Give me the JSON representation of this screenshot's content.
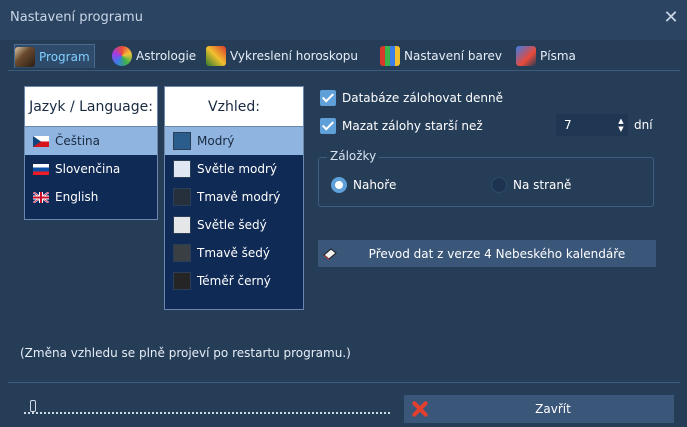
{
  "window": {
    "title": "Nastavení programu",
    "close_glyph": "✕"
  },
  "tabs": [
    {
      "label": "Program",
      "icon": "wizard-icon",
      "active": true
    },
    {
      "label": "Astrologie",
      "icon": "zodiac-wheel-icon",
      "active": false
    },
    {
      "label": "Vykreslení horoskopu",
      "icon": "paint-brush-icon",
      "active": false
    },
    {
      "label": "Nastavení barev",
      "icon": "color-bars-icon",
      "active": false
    },
    {
      "label": "Písma",
      "icon": "fonts-icon",
      "active": false
    }
  ],
  "language": {
    "header": "Jazyk / Language:",
    "items": [
      {
        "label": "Čeština",
        "flag": "czech-flag-icon",
        "selected": true
      },
      {
        "label": "Slovenčina",
        "flag": "slovak-flag-icon",
        "selected": false
      },
      {
        "label": "English",
        "flag": "uk-flag-icon",
        "selected": false
      }
    ]
  },
  "appearance": {
    "header": "Vzhled:",
    "items": [
      {
        "label": "Modrý",
        "color": "#2a5c8c",
        "selected": true
      },
      {
        "label": "Světle modrý",
        "color": "#dfe8f2",
        "selected": false
      },
      {
        "label": "Tmavě modrý",
        "color": "#26303c",
        "selected": false
      },
      {
        "label": "Světle šedý",
        "color": "#e4e6e8",
        "selected": false
      },
      {
        "label": "Tmavě šedý",
        "color": "#3a3f44",
        "selected": false
      },
      {
        "label": "Téměř černý",
        "color": "#252525",
        "selected": false
      }
    ]
  },
  "options": {
    "backup_daily": {
      "label": "Databáze zálohovat denně",
      "checked": true
    },
    "delete_older": {
      "label": "Mazat zálohy starší než",
      "checked": true
    },
    "days_value": "7",
    "days_unit": "dní"
  },
  "tabs_position": {
    "legend": "Záložky",
    "top": {
      "label": "Nahoře",
      "selected": true
    },
    "side": {
      "label": "Na straně",
      "selected": false
    }
  },
  "convert_button": {
    "label": "Převod dat z verze 4 Nebeského kalendáře"
  },
  "note": "(Změna vzhledu se plně projeví po restartu programu.)",
  "progress": {
    "value_fraction": 0.0
  },
  "close_button": {
    "label": "Zavřít"
  },
  "colors": {
    "window_bg": "#263d58",
    "accent": "#5fa0d8",
    "selection": "#8fb4e0",
    "close_x": "#e2402f"
  }
}
